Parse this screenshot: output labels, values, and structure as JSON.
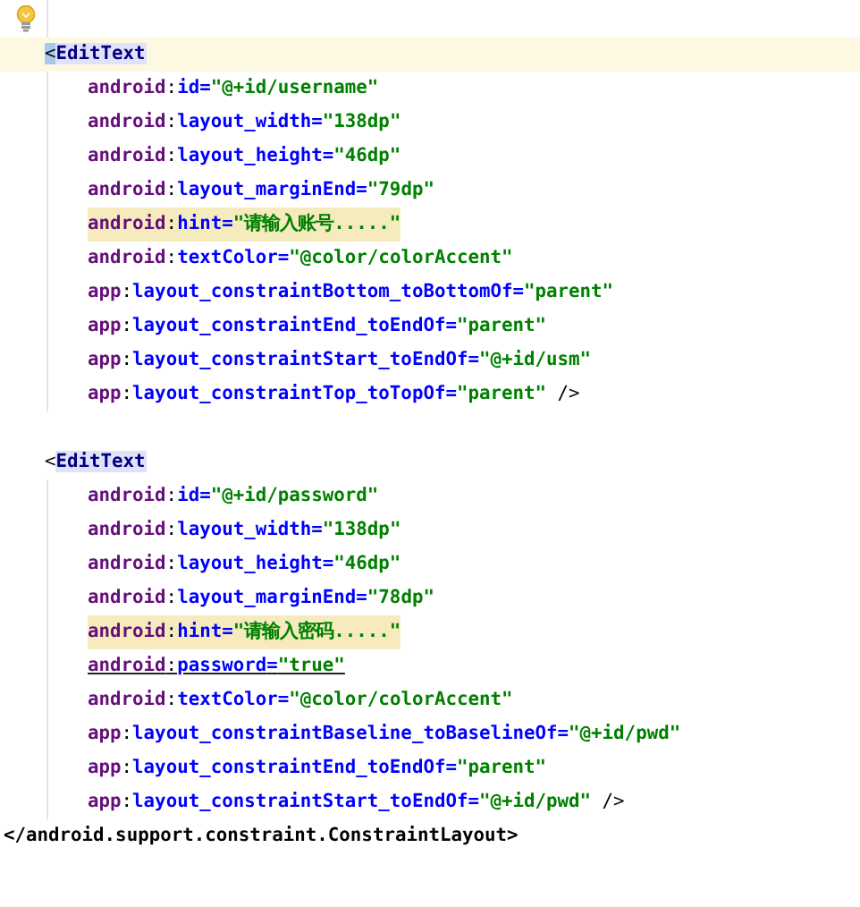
{
  "lines": [
    {
      "kind": "open",
      "bracket": "<",
      "tag": "EditText",
      "current": true
    },
    {
      "kind": "attr",
      "ns": "android",
      "colon": ":",
      "name": "id",
      "eq": "=",
      "value": "\"@+id/username\"",
      "highlighted": false,
      "deprecated": false
    },
    {
      "kind": "attr",
      "ns": "android",
      "colon": ":",
      "name": "layout_width",
      "eq": "=",
      "value": "\"138dp\"",
      "highlighted": false,
      "deprecated": false
    },
    {
      "kind": "attr",
      "ns": "android",
      "colon": ":",
      "name": "layout_height",
      "eq": "=",
      "value": "\"46dp\"",
      "highlighted": false,
      "deprecated": false
    },
    {
      "kind": "attr",
      "ns": "android",
      "colon": ":",
      "name": "layout_marginEnd",
      "eq": "=",
      "value": "\"79dp\"",
      "highlighted": false,
      "deprecated": false
    },
    {
      "kind": "attr",
      "ns": "android",
      "colon": ":",
      "name": "hint",
      "eq": "=",
      "value": "\"请输入账号.....\"",
      "highlighted": true,
      "deprecated": false
    },
    {
      "kind": "attr",
      "ns": "android",
      "colon": ":",
      "name": "textColor",
      "eq": "=",
      "value": "\"@color/colorAccent\"",
      "highlighted": false,
      "deprecated": false
    },
    {
      "kind": "attr",
      "ns": "app",
      "colon": ":",
      "name": "layout_constraintBottom_toBottomOf",
      "eq": "=",
      "value": "\"parent\"",
      "highlighted": false,
      "deprecated": false
    },
    {
      "kind": "attr",
      "ns": "app",
      "colon": ":",
      "name": "layout_constraintEnd_toEndOf",
      "eq": "=",
      "value": "\"parent\"",
      "highlighted": false,
      "deprecated": false
    },
    {
      "kind": "attr",
      "ns": "app",
      "colon": ":",
      "name": "layout_constraintStart_toEndOf",
      "eq": "=",
      "value": "\"@+id/usm\"",
      "highlighted": false,
      "deprecated": false
    },
    {
      "kind": "attr",
      "ns": "app",
      "colon": ":",
      "name": "layout_constraintTop_toTopOf",
      "eq": "=",
      "value": "\"parent\"",
      "highlighted": false,
      "deprecated": false,
      "end": "/>"
    },
    {
      "kind": "blank"
    },
    {
      "kind": "open",
      "bracket": "<",
      "tag": "EditText",
      "current": false
    },
    {
      "kind": "attr",
      "ns": "android",
      "colon": ":",
      "name": "id",
      "eq": "=",
      "value": "\"@+id/password\"",
      "highlighted": false,
      "deprecated": false
    },
    {
      "kind": "attr",
      "ns": "android",
      "colon": ":",
      "name": "layout_width",
      "eq": "=",
      "value": "\"138dp\"",
      "highlighted": false,
      "deprecated": false
    },
    {
      "kind": "attr",
      "ns": "android",
      "colon": ":",
      "name": "layout_height",
      "eq": "=",
      "value": "\"46dp\"",
      "highlighted": false,
      "deprecated": false
    },
    {
      "kind": "attr",
      "ns": "android",
      "colon": ":",
      "name": "layout_marginEnd",
      "eq": "=",
      "value": "\"78dp\"",
      "highlighted": false,
      "deprecated": false
    },
    {
      "kind": "attr",
      "ns": "android",
      "colon": ":",
      "name": "hint",
      "eq": "=",
      "value": "\"请输入密码.....\"",
      "highlighted": true,
      "deprecated": false
    },
    {
      "kind": "attr",
      "ns": "android",
      "colon": ":",
      "name": "password",
      "eq": "=",
      "value": "\"true\"",
      "highlighted": false,
      "deprecated": true
    },
    {
      "kind": "attr",
      "ns": "android",
      "colon": ":",
      "name": "textColor",
      "eq": "=",
      "value": "\"@color/colorAccent\"",
      "highlighted": false,
      "deprecated": false
    },
    {
      "kind": "attr",
      "ns": "app",
      "colon": ":",
      "name": "layout_constraintBaseline_toBaselineOf",
      "eq": "=",
      "value": "\"@+id/pwd\"",
      "highlighted": false,
      "deprecated": false
    },
    {
      "kind": "attr",
      "ns": "app",
      "colon": ":",
      "name": "layout_constraintEnd_toEndOf",
      "eq": "=",
      "value": "\"parent\"",
      "highlighted": false,
      "deprecated": false
    },
    {
      "kind": "attr",
      "ns": "app",
      "colon": ":",
      "name": "layout_constraintStart_toEndOf",
      "eq": "=",
      "value": "\"@+id/pwd\"",
      "highlighted": false,
      "deprecated": false,
      "end": "/>"
    },
    {
      "kind": "close",
      "text": "</android.support.constraint.ConstraintLayout>"
    }
  ]
}
